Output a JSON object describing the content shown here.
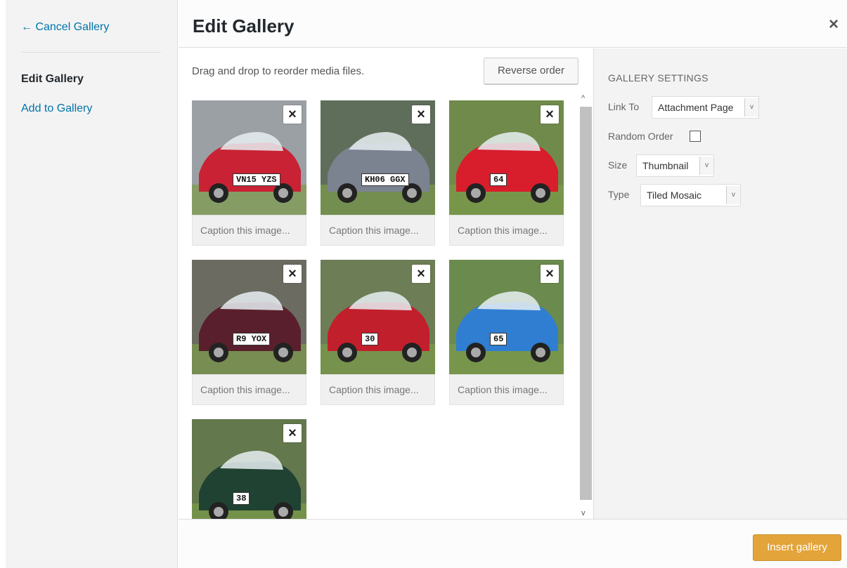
{
  "sidebar": {
    "cancel_label": "← Cancel Gallery",
    "items": [
      {
        "label": "Edit Gallery",
        "active": true
      },
      {
        "label": "Add to Gallery",
        "active": false
      }
    ]
  },
  "header": {
    "title": "Edit Gallery",
    "close_glyph": "×"
  },
  "content": {
    "instructions": "Drag and drop to reorder media files.",
    "reverse_label": "Reverse order",
    "remove_glyph": "×",
    "tiles": [
      {
        "caption": "Caption this image...",
        "car_color": "#c82234",
        "plate": "VN15 YZS"
      },
      {
        "caption": "Caption this image...",
        "car_color": "#7b8290",
        "plate": "KH06 GGX"
      },
      {
        "caption": "Caption this image...",
        "car_color": "#d81d2c",
        "plate": "64"
      },
      {
        "caption": "Caption this image...",
        "car_color": "#5a1f2c",
        "plate": "R9 YOX"
      },
      {
        "caption": "Caption this image...",
        "car_color": "#c21f2c",
        "plate": "30"
      },
      {
        "caption": "Caption this image...",
        "car_color": "#2f7ed2",
        "plate": "65"
      },
      {
        "caption": "",
        "car_color": "#204232",
        "plate": "38"
      }
    ]
  },
  "settings": {
    "heading": "GALLERY SETTINGS",
    "link_to_label": "Link To",
    "link_to_value": "Attachment Page",
    "random_label": "Random Order",
    "size_label": "Size",
    "size_value": "Thumbnail",
    "type_label": "Type",
    "type_value": "Tiled Mosaic"
  },
  "footer": {
    "insert_label": "Insert gallery"
  },
  "colors": {
    "link": "#0073aa",
    "primary_button": "#e3a43a"
  }
}
